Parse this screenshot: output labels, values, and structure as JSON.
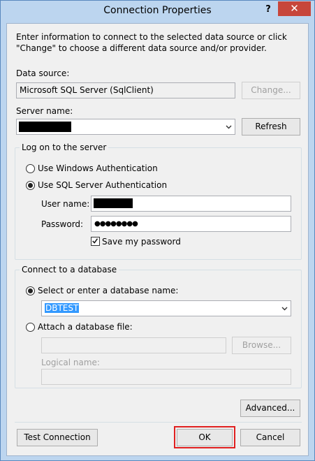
{
  "window": {
    "title": "Connection Properties",
    "help_label": "?",
    "close_label": "✕"
  },
  "intro_text": "Enter information to connect to the selected data source or click \"Change\" to choose a different data source and/or provider.",
  "data_source": {
    "label": "Data source:",
    "value": "Microsoft SQL Server (SqlClient)",
    "change_button": "Change..."
  },
  "server": {
    "label": "Server name:",
    "value": "",
    "refresh_button": "Refresh"
  },
  "logon": {
    "group_title": "Log on to the server",
    "windows_auth_label": "Use Windows Authentication",
    "sql_auth_label": "Use SQL Server Authentication",
    "selected": "sql",
    "username_label": "User name:",
    "password_label": "Password:",
    "password_value": "●●●●●●●●",
    "save_password_label": "Save my password",
    "save_password_checked": true
  },
  "database": {
    "group_title": "Connect to a database",
    "select_label": "Select or enter a database name:",
    "db_name": "DBTEST",
    "attach_label": "Attach a database file:",
    "browse_button": "Browse...",
    "logical_name_label": "Logical name:"
  },
  "buttons": {
    "advanced": "Advanced...",
    "test_connection": "Test Connection",
    "ok": "OK",
    "cancel": "Cancel"
  }
}
